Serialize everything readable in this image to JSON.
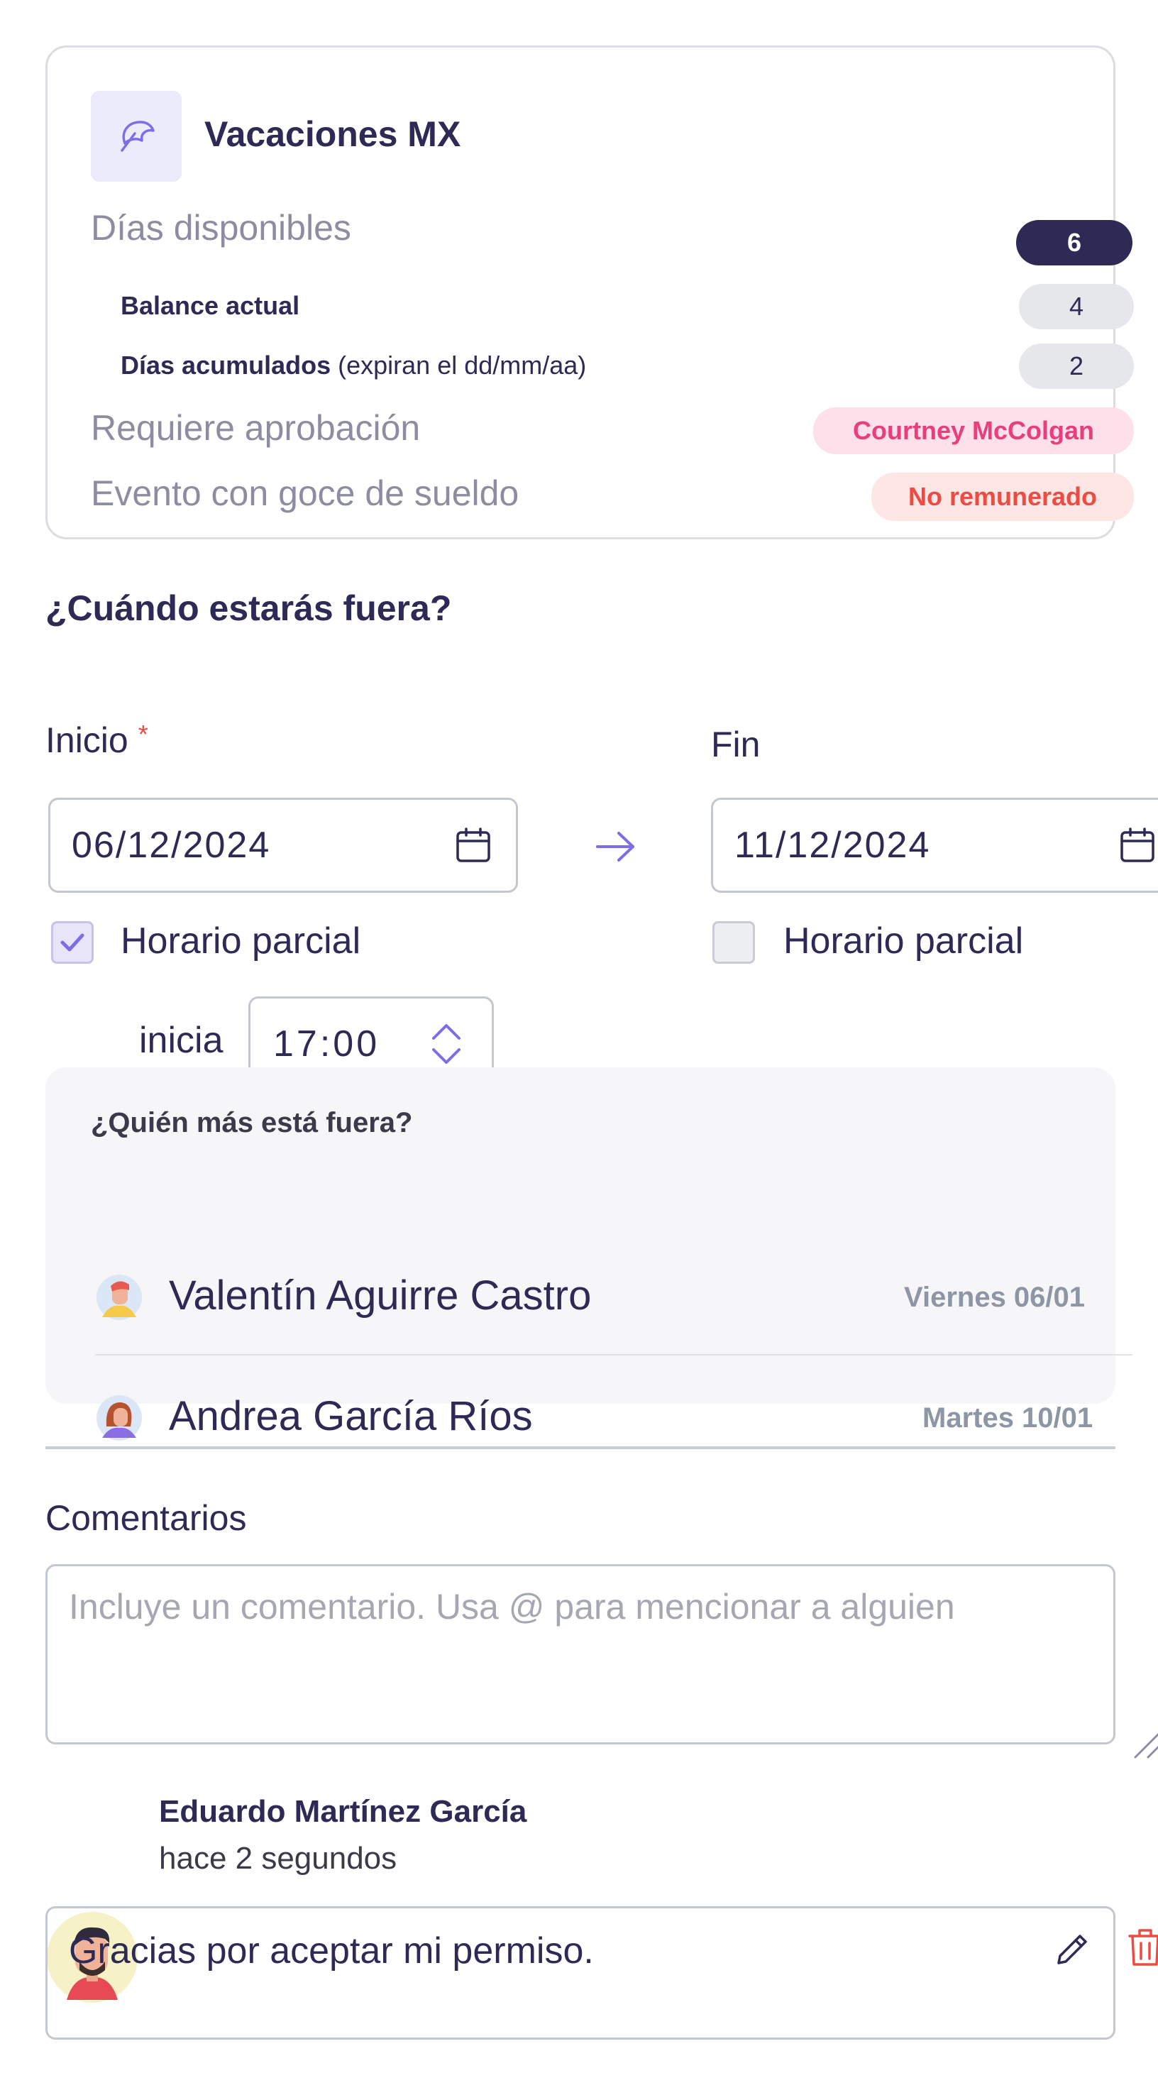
{
  "policy": {
    "title": "Vacaciones MX",
    "icon": "umbrella-icon",
    "available_label": "Días disponibles",
    "available_value": "6",
    "balance_label": "Balance actual",
    "balance_value": "4",
    "accrued_label": "Días acumulados",
    "accrued_note": "(expiran el dd/mm/aa)",
    "accrued_value": "2",
    "approval_label": "Requiere aprobación",
    "approver": "Courtney McColgan",
    "paid_label": "Evento con goce de sueldo",
    "paid_value": "No remunerado"
  },
  "when": {
    "title": "¿Cuándo estarás fuera?",
    "start_label": "Inicio",
    "required_mark": "*",
    "end_label": "Fin",
    "start_date": "06/12/2024",
    "end_date": "11/12/2024",
    "start_partial_label": "Horario parcial",
    "start_partial_checked": true,
    "end_partial_label": "Horario parcial",
    "end_partial_checked": false,
    "starts_label": "inicia",
    "start_time_h": "17",
    "start_time_sep": ":",
    "start_time_m": "00"
  },
  "who_else": {
    "title": "¿Quién más está fuera?",
    "people": [
      {
        "name": "Valentín Aguirre Castro",
        "date": "Viernes 06/01"
      },
      {
        "name": "Andrea García Ríos",
        "date": "Martes 10/01"
      }
    ]
  },
  "comments": {
    "label": "Comentarios",
    "placeholder": "Incluye un comentario. Usa @ para mencionar a alguien",
    "author": "Eduardo Martínez García",
    "time": "hace 2 segundos",
    "text": "Gracias por aceptar mi permiso."
  },
  "colors": {
    "primary": "#2d2a55",
    "accent": "#7b6ee8",
    "danger": "#ec4c42",
    "pink": "#e83e7c"
  }
}
